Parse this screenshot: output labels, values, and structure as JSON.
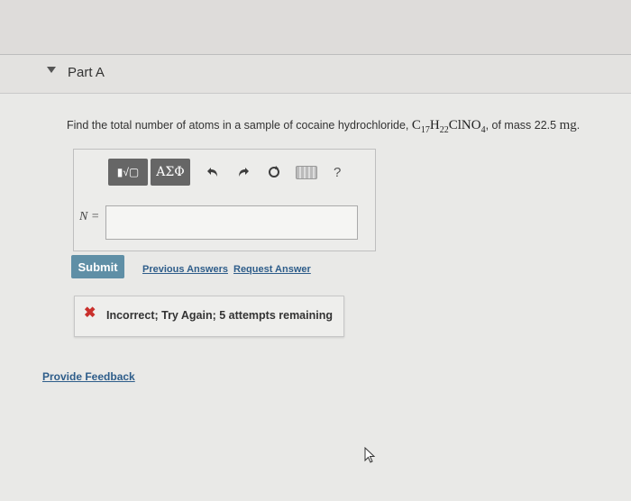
{
  "part": {
    "title": "Part A"
  },
  "question": {
    "prefix": "Find the total number of atoms in a sample of cocaine hydrochloride,",
    "formula": [
      {
        "el": "C",
        "sub": "17"
      },
      {
        "el": "H",
        "sub": "22"
      },
      {
        "el": "ClNO",
        "sub": "4"
      }
    ],
    "middle": ", of mass 22.5",
    "unit": "mg",
    "suffix": "."
  },
  "toolbar": {
    "templates_label": "▮√▢",
    "greek_label": "ΑΣΦ",
    "help_label": "?",
    "icons": [
      "undo-icon",
      "redo-icon",
      "reset-icon",
      "keyboard-icon",
      "help-icon"
    ]
  },
  "answer": {
    "variable_label": "N =",
    "value": ""
  },
  "actions": {
    "submit_label": "Submit",
    "previous_answers_label": "Previous Answers",
    "request_answer_label": "Request Answer"
  },
  "feedback": {
    "message": "Incorrect; Try Again; 5 attempts remaining",
    "status_color": "#c9302c"
  },
  "footer": {
    "provide_feedback_label": "Provide Feedback"
  },
  "colors": {
    "submit_bg": "#5f8fa6",
    "link": "#2e5d8a"
  }
}
